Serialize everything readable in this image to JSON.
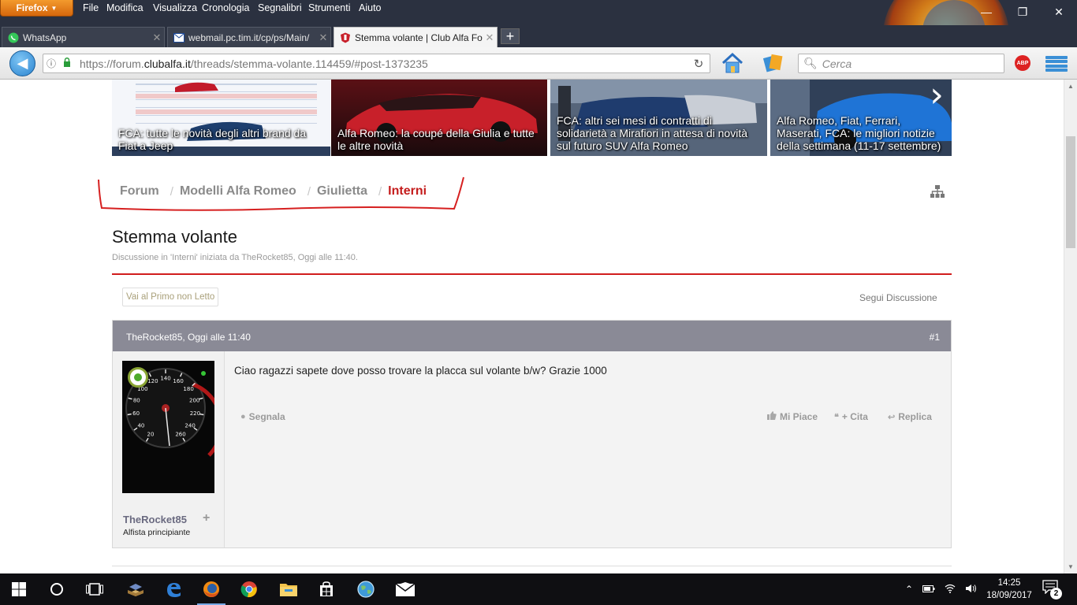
{
  "browser": {
    "app_button": "Firefox",
    "menu": [
      "File",
      "Modifica",
      "Visualizza",
      "Cronologia",
      "Segnalibri",
      "Strumenti",
      "Aiuto"
    ],
    "tabs": [
      {
        "title": "WhatsApp",
        "active": false
      },
      {
        "title": "webmail.pc.tim.it/cp/ps/Main/",
        "active": false
      },
      {
        "title": "Stemma volante | Club Alfa Fo",
        "active": true
      }
    ],
    "url_prefix": "https://forum.",
    "url_host": "clubalfa.it",
    "url_path": "/threads/stemma-volante.114459/#post-1373235",
    "search_placeholder": "Cerca",
    "abp_label": "ABP"
  },
  "carousel": [
    {
      "caption": "FCA: tutte le novità degli altri brand da Fiat a Jeep"
    },
    {
      "caption": "Alfa Romeo: la coupé della Giulia e tutte le altre novità"
    },
    {
      "caption": "FCA: altri sei mesi di contratti di solidarietà a Mirafiori in attesa di novità sul futuro SUV Alfa Romeo"
    },
    {
      "caption": "Alfa Romeo, Fiat, Ferrari, Maserati, FCA: le migliori notizie della settimana (11-17 settembre)"
    }
  ],
  "breadcrumb": [
    "Forum",
    "Modelli Alfa Romeo",
    "Giulietta",
    "Interni"
  ],
  "thread": {
    "title": "Stemma volante",
    "meta": "Discussione in 'Interni' iniziata da TheRocket85, Oggi alle 11:40.",
    "unread_button": "Vai al Primo non Letto",
    "follow_link": "Segui Discussione"
  },
  "post": {
    "header": "TheRocket85, Oggi alle 11:40",
    "number": "#1",
    "username": "TheRocket85",
    "user_title": "Alfista principiante",
    "body": "Ciao ragazzi sapete dove posso trovare la placca sul volante b/w? Grazie 1000",
    "actions": {
      "report": "Segnala",
      "like": "Mi Piace",
      "quote": "+ Cita",
      "reply": "Replica"
    },
    "speedo_numbers": [
      "20",
      "40",
      "60",
      "80",
      "100",
      "120",
      "140",
      "160",
      "180",
      "200",
      "220",
      "240",
      "260"
    ]
  },
  "taskbar": {
    "time": "14:25",
    "date": "18/09/2017",
    "notifications": "2"
  },
  "colors": {
    "accent_red": "#c41c1c",
    "post_header": "#8a8a96",
    "firefox_orange": "#e07a1f"
  }
}
